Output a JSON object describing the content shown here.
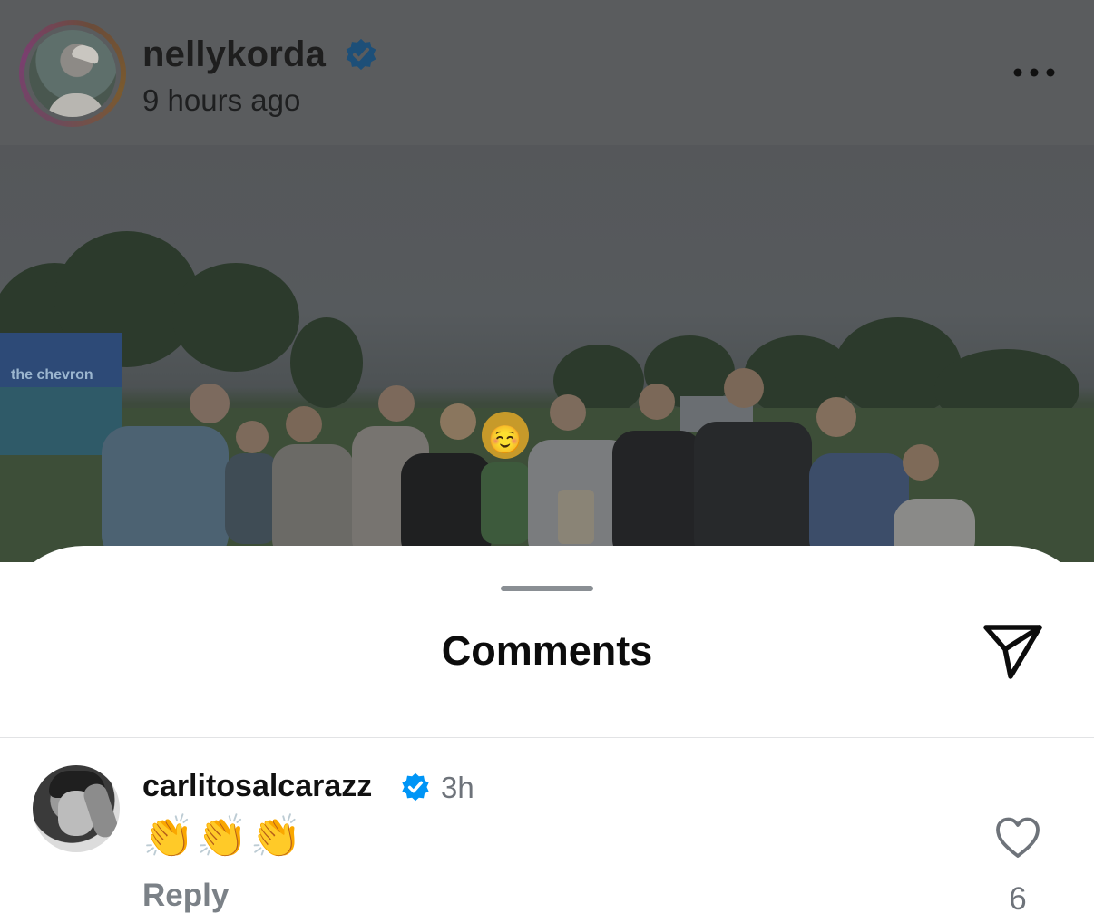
{
  "post": {
    "username": "nellykorda",
    "time_ago": "9 hours ago",
    "verified_icon": "verified-badge-icon",
    "more_icon": "more-options-icon",
    "photo_banner_text": "the chevron",
    "emoji_sticker": "☺️"
  },
  "comments_sheet": {
    "title": "Comments",
    "share_icon": "share-send-icon"
  },
  "comments": [
    {
      "username": "carlitosalcarazz",
      "verified": true,
      "time": "3h",
      "text": "👏👏👏",
      "reply_label": "Reply",
      "likes": "6"
    }
  ],
  "colors": {
    "dim_overlay": "#5a5c5e",
    "verified_blue": "#0095f6",
    "text_primary": "#0c0c0c",
    "text_secondary": "#6e737a"
  }
}
